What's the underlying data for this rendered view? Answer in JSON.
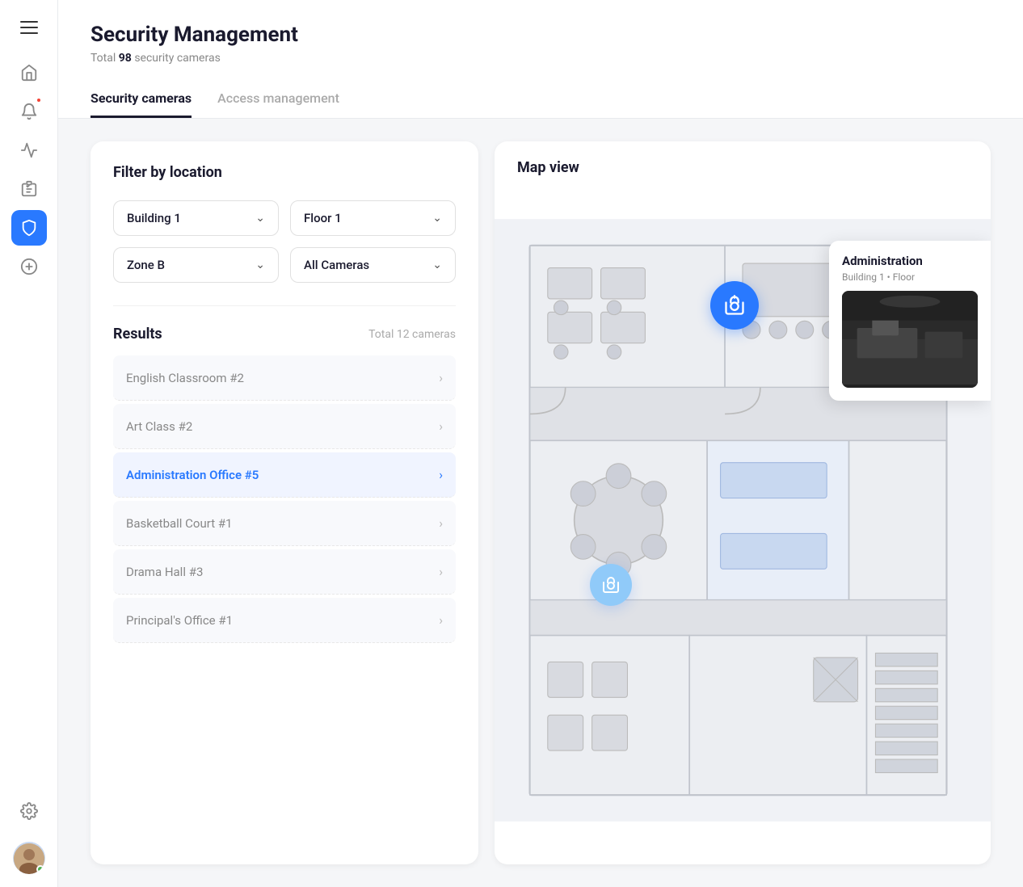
{
  "page": {
    "title": "Security Management",
    "subtitle_prefix": "Total",
    "subtitle_count": "98",
    "subtitle_suffix": "security cameras"
  },
  "tabs": [
    {
      "id": "cameras",
      "label": "Security cameras",
      "active": true
    },
    {
      "id": "access",
      "label": "Access management",
      "active": false
    }
  ],
  "filter": {
    "title": "Filter by location",
    "building_value": "Building 1",
    "floor_value": "Floor 1",
    "zone_value": "Zone B",
    "camera_type_value": "All Cameras"
  },
  "results": {
    "title": "Results",
    "total_label": "Total 12 cameras",
    "cameras": [
      {
        "name": "English Classroom #2",
        "active": false
      },
      {
        "name": "Art Class #2",
        "active": false
      },
      {
        "name": "Administration Office #5",
        "active": true
      },
      {
        "name": "Basketball Court #1",
        "active": false
      },
      {
        "name": "Drama Hall #3",
        "active": false
      },
      {
        "name": "Principal's Office #1",
        "active": false
      }
    ]
  },
  "map": {
    "title": "Map view",
    "active_camera": {
      "label": "Administration",
      "building": "Building 1",
      "floor": "Floor"
    }
  },
  "sidebar": {
    "icons": [
      {
        "id": "home",
        "symbol": "⌂",
        "active": false
      },
      {
        "id": "bell",
        "symbol": "🔔",
        "active": false,
        "has_badge": true
      },
      {
        "id": "monitor",
        "symbol": "⊡",
        "active": false
      },
      {
        "id": "clipboard",
        "symbol": "📋",
        "active": false
      },
      {
        "id": "shield",
        "symbol": "🛡",
        "active": true
      },
      {
        "id": "dollar",
        "symbol": "＄",
        "active": false
      },
      {
        "id": "settings",
        "symbol": "⚙",
        "active": false
      }
    ]
  }
}
